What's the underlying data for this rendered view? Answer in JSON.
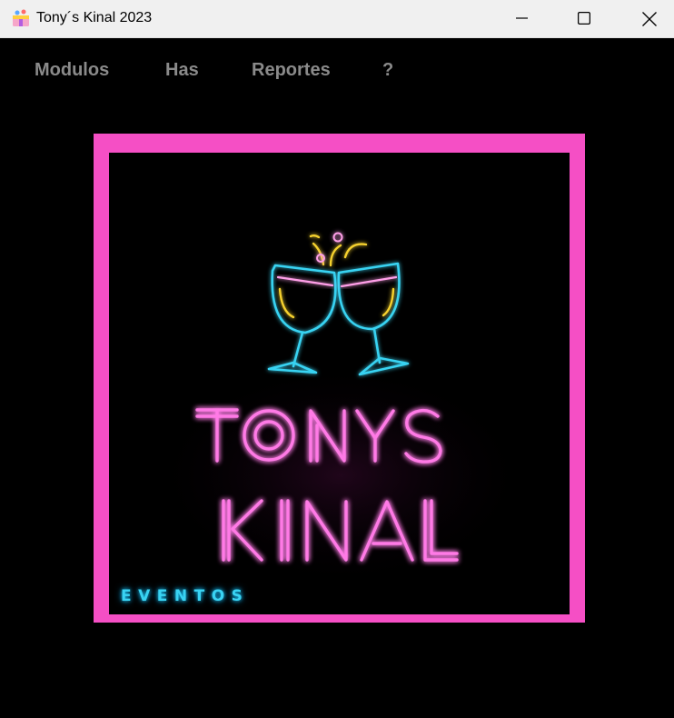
{
  "window": {
    "title": "Tony´s Kinal 2023",
    "icon": "app-icon"
  },
  "menu": {
    "items": [
      "Modulos",
      "Has",
      "Reportes",
      "?"
    ]
  },
  "logo": {
    "line1": "TONYS",
    "line2": "KINAL",
    "tagline": "EVENTOS",
    "icon": "toasting-glasses-icon"
  },
  "colors": {
    "frame": "#f54fc5",
    "neon_pink": "#ff7ae6",
    "neon_cyan": "#39d3f2",
    "neon_yellow": "#f5d12e"
  }
}
